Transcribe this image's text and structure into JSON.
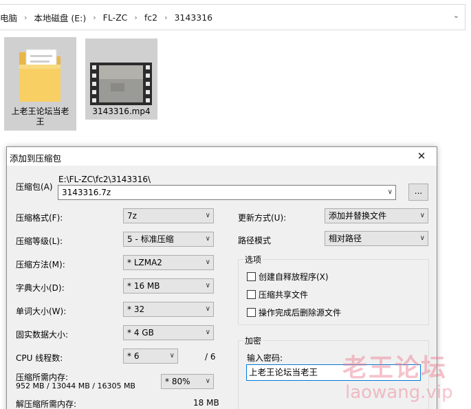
{
  "explorer": {
    "breadcrumbs": [
      "电脑",
      "本地磁盘 (E:)",
      "FL-ZC",
      "fc2",
      "3143316"
    ],
    "files": [
      {
        "name": "上老王论坛当老王",
        "type": "folder-icon"
      },
      {
        "name": "3143316.mp4",
        "type": "video-file-icon"
      }
    ]
  },
  "dialog": {
    "title": "添加到压缩包",
    "close": "✕",
    "archive_label": "压缩包(A)",
    "archive_path": "E:\\FL-ZC\\fc2\\3143316\\",
    "archive_name": "3143316.7z",
    "browse_label": "...",
    "format_label": "压缩格式(F):",
    "format_value": "7z",
    "level_label": "压缩等级(L):",
    "level_value": "5 - 标准压缩",
    "method_label": "压缩方法(M):",
    "method_value": "* LZMA2",
    "dict_label": "字典大小(D):",
    "dict_value": "* 16 MB",
    "word_label": "单词大小(W):",
    "word_value": "* 32",
    "solid_label": "固实数据大小:",
    "solid_value": "* 4 GB",
    "threads_label": "CPU 线程数:",
    "threads_value": "* 6",
    "threads_total": "/ 6",
    "mem_label": "压缩所需内存:",
    "mem_value": "952 MB / 13044 MB / 16305 MB",
    "mem_percent": "* 80%",
    "decomp_label": "解压缩所需内存:",
    "decomp_value": "18 MB",
    "update_label": "更新方式(U):",
    "update_value": "添加并替换文件",
    "path_label": "路径模式",
    "path_value": "相对路径",
    "options_title": "选项",
    "opt_sfx": "创建自释放程序(X)",
    "opt_shared": "压缩共享文件",
    "opt_delete": "操作完成后删除源文件",
    "encrypt_title": "加密",
    "password_label": "输入密码:",
    "password_value": "上老王论坛当老王"
  },
  "watermark": {
    "cn": "老王论坛",
    "en": "laowang.vip"
  }
}
